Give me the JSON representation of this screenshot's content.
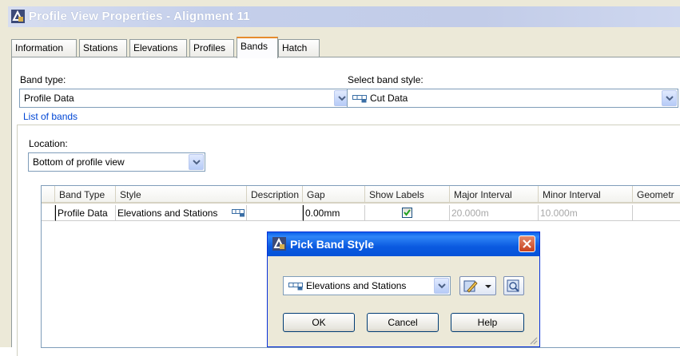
{
  "window": {
    "title": "Profile View Properties - Alignment 11"
  },
  "tabs": [
    {
      "label": "Information"
    },
    {
      "label": "Stations"
    },
    {
      "label": "Elevations"
    },
    {
      "label": "Profiles"
    },
    {
      "label": "Bands",
      "active": true
    },
    {
      "label": "Hatch"
    }
  ],
  "band_type": {
    "label": "Band type:",
    "value": "Profile Data"
  },
  "band_style": {
    "label": "Select band style:",
    "value": "Cut Data"
  },
  "list_of_bands": {
    "label": "List of bands",
    "location_label": "Location:",
    "location_value": "Bottom of profile view"
  },
  "table": {
    "columns": [
      "Band Type",
      "Style",
      "Description",
      "Gap",
      "Show Labels",
      "Major Interval",
      "Minor Interval",
      "Geometr"
    ],
    "rows": [
      {
        "band_type": "Profile Data",
        "style": "Elevations and Stations",
        "description": "",
        "gap": "0.00mm",
        "show_labels": true,
        "major_interval": "20.000m",
        "minor_interval": "10.000m",
        "geometry": ""
      }
    ]
  },
  "pick_dialog": {
    "title": "Pick Band Style",
    "selected_style": "Elevations and Stations",
    "ok_label": "OK",
    "cancel_label": "Cancel",
    "help_label": "Help"
  },
  "colors": {
    "titlebar_blue": "#0a5fe9",
    "group_label": "#0046d5",
    "active_tab_accent": "#e68b2c",
    "close_red": "#c7411e"
  },
  "icons": {
    "app": "autocad-civil-icon",
    "band_style": "band-style-icon",
    "dropdown": "chevron-down-icon",
    "edit": "edit-style-icon",
    "preview": "preview-icon",
    "close": "close-icon"
  }
}
